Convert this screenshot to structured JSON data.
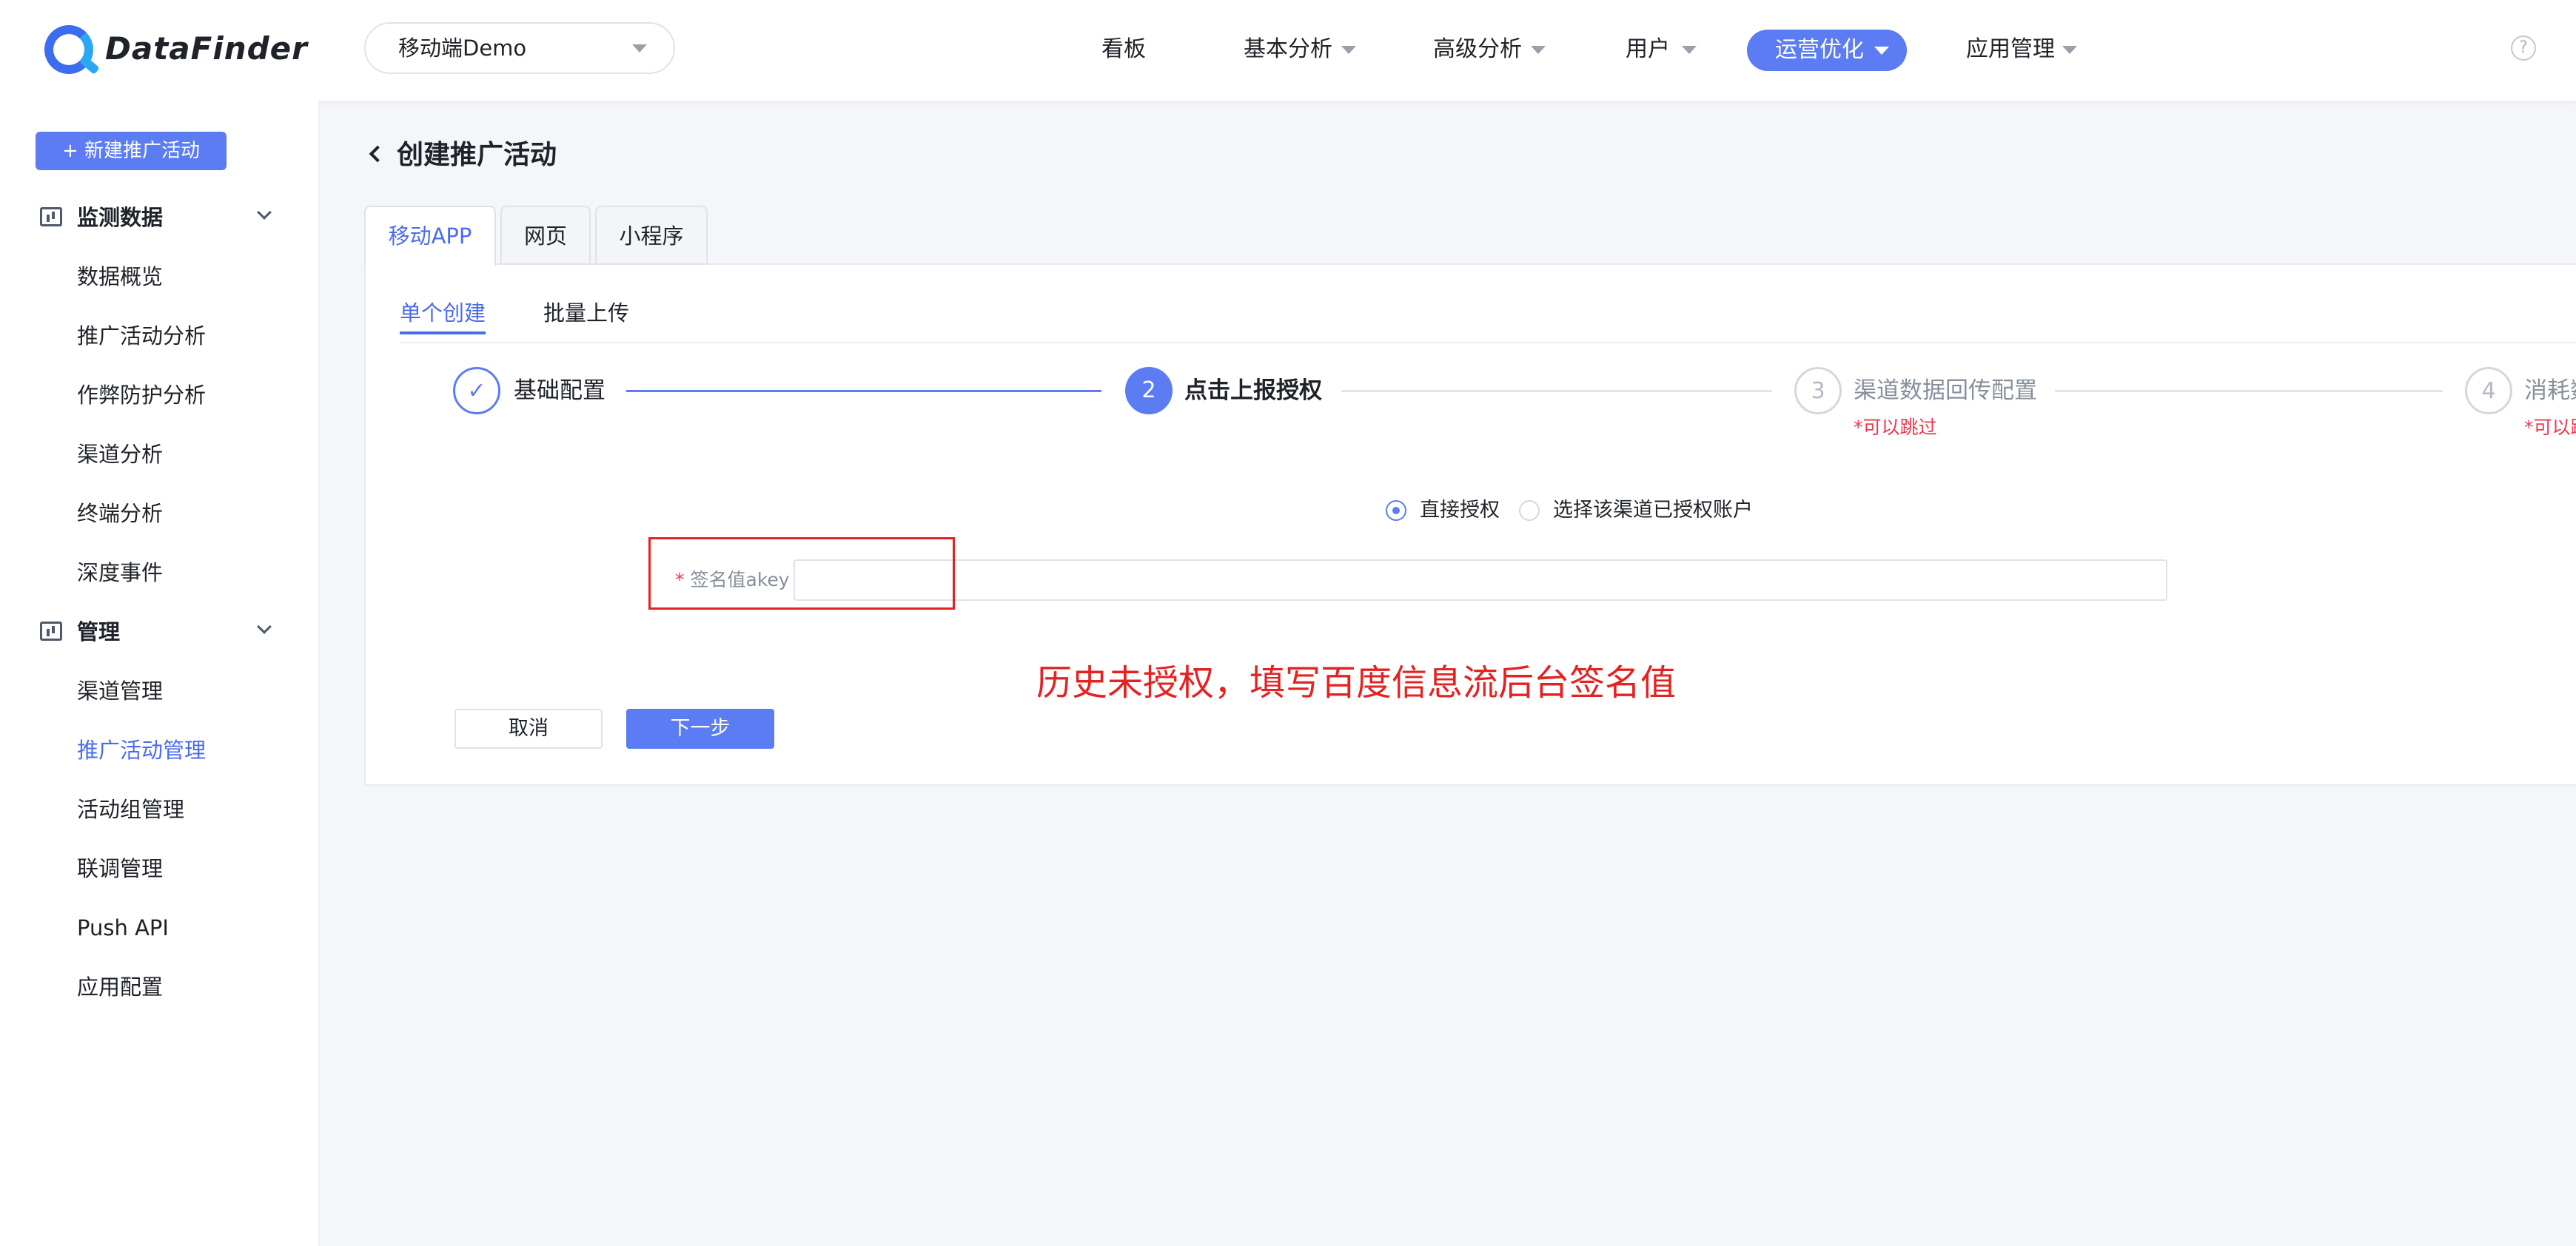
{
  "app": {
    "logo_text": "DataFinder",
    "project_selector": "移动端Demo"
  },
  "nav": {
    "items": [
      "看板",
      "基本分析",
      "高级分析",
      "用户",
      "运营优化",
      "应用管理"
    ],
    "active": "运营优化",
    "help": "?"
  },
  "sidebar": {
    "new_button": "+ 新建推广活动",
    "groups": [
      {
        "label": "监测数据",
        "icon": "bar-chart-icon",
        "items": [
          "数据概览",
          "推广活动分析",
          "作弊防护分析",
          "渠道分析",
          "终端分析",
          "深度事件"
        ]
      },
      {
        "label": "管理",
        "icon": "monitor-chart-icon",
        "items": [
          "渠道管理",
          "推广活动管理",
          "活动组管理",
          "联调管理",
          "Push API",
          "应用配置"
        ]
      }
    ],
    "active_item": "推广活动管理"
  },
  "page": {
    "title": "创建推广活动",
    "tabs": [
      "移动APP",
      "网页",
      "小程序"
    ],
    "subtabs": [
      "单个创建",
      "批量上传"
    ]
  },
  "steps": [
    {
      "num": "✓",
      "label": "基础配置",
      "note": ""
    },
    {
      "num": "2",
      "label": "点击上报授权",
      "note": ""
    },
    {
      "num": "3",
      "label": "渠道数据回传配置",
      "note": "*可以跳过"
    },
    {
      "num": "4",
      "label": "消耗数据",
      "note": "*可以跳过"
    }
  ],
  "form": {
    "radio_options": [
      "直接授权",
      "选择该渠道已授权账户"
    ],
    "radio_selected": "直接授权",
    "field_required": "*",
    "field_label": "签名值akey",
    "field_value": "",
    "cancel_label": "取消",
    "next_label": "下一步"
  },
  "annotation": "历史未授权，填写百度信息流后台签名值",
  "colors": {
    "primary": "#5b7cf3",
    "annotation_red": "#e52222",
    "required_red": "#f0364f"
  }
}
